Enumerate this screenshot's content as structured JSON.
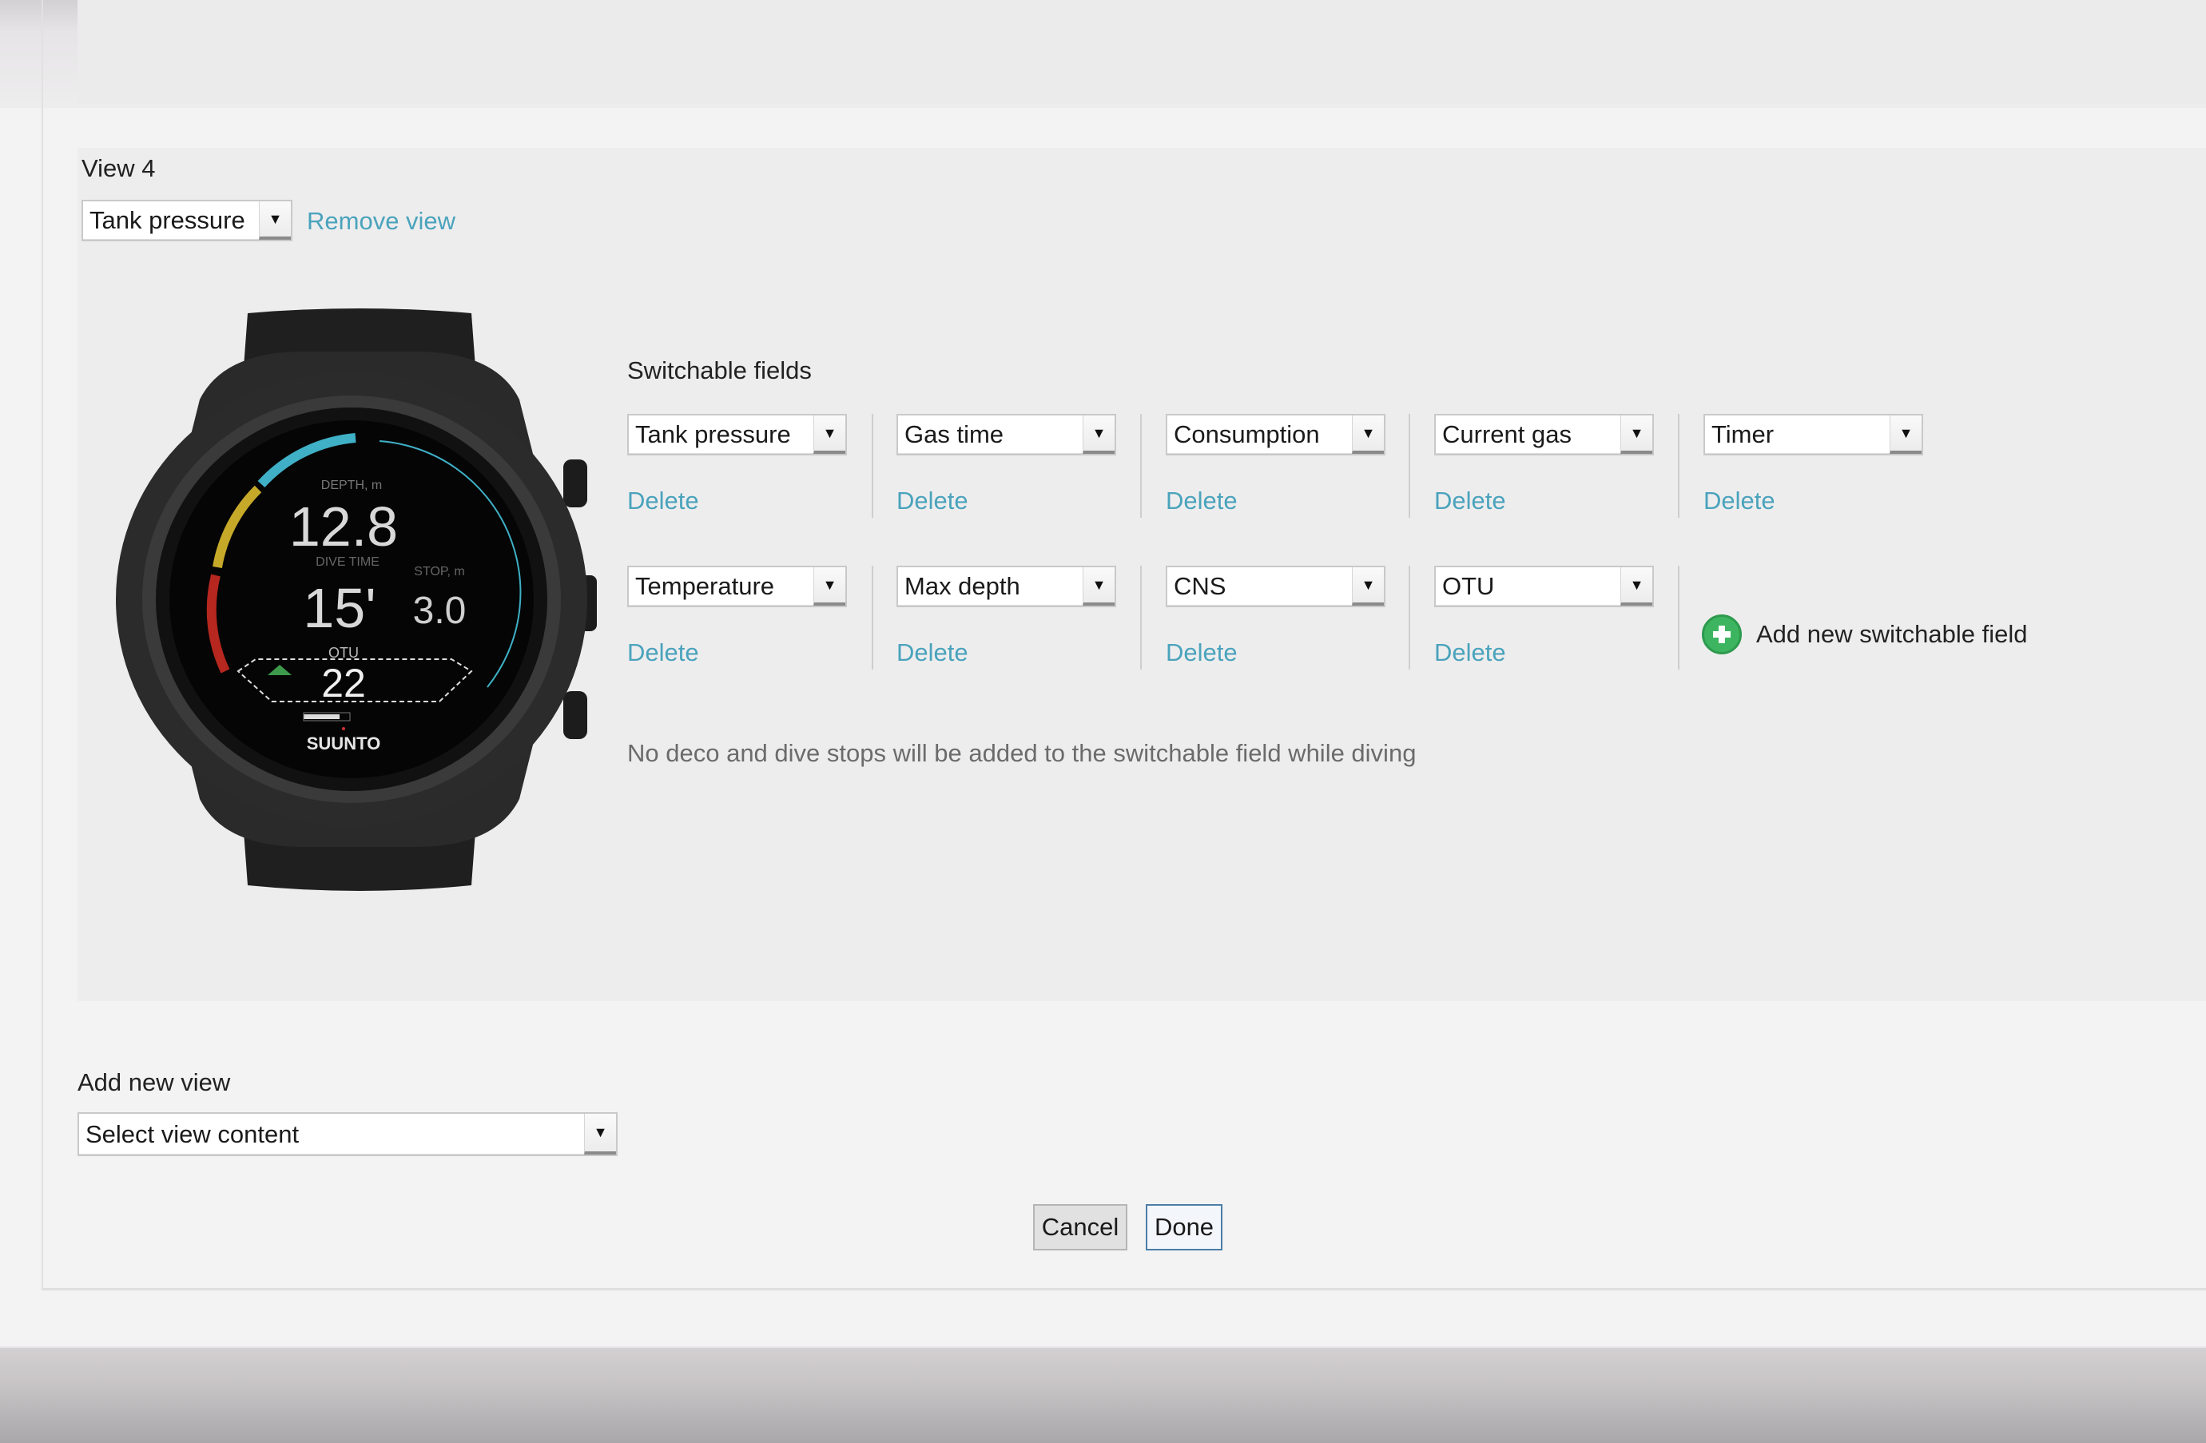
{
  "view": {
    "title": "View 4",
    "content_select": "Tank pressure",
    "remove_link": "Remove view"
  },
  "watch": {
    "brand": "SUUNTO",
    "depth_label": "DEPTH, m",
    "depth_value": "12.8",
    "dive_time_label": "DIVE TIME",
    "dive_time_value": "15'",
    "stop_label": "STOP, m",
    "stop_value": "3.0",
    "field_label": "OTU",
    "field_value": "22",
    "colors": {
      "arc_cyan": "#3fb0c6",
      "arc_yellow": "#c7a92a",
      "arc_red": "#b5271f",
      "accent_green": "#3d9a4c"
    }
  },
  "switchable": {
    "heading": "Switchable fields",
    "delete_label": "Delete",
    "rows": [
      [
        "Tank pressure",
        "Gas time",
        "Consumption",
        "Current gas",
        "Timer"
      ],
      [
        "Temperature",
        "Max depth",
        "CNS",
        "OTU"
      ]
    ],
    "add_label": "Add new switchable field",
    "note": "No deco and dive stops will be added to the switchable field while diving"
  },
  "add_view": {
    "label": "Add new view",
    "select_placeholder": "Select view content"
  },
  "buttons": {
    "cancel": "Cancel",
    "done": "Done"
  },
  "colors": {
    "link": "#4aa3bc",
    "add_green": "#3db560",
    "done_border": "#4a7ea8"
  }
}
